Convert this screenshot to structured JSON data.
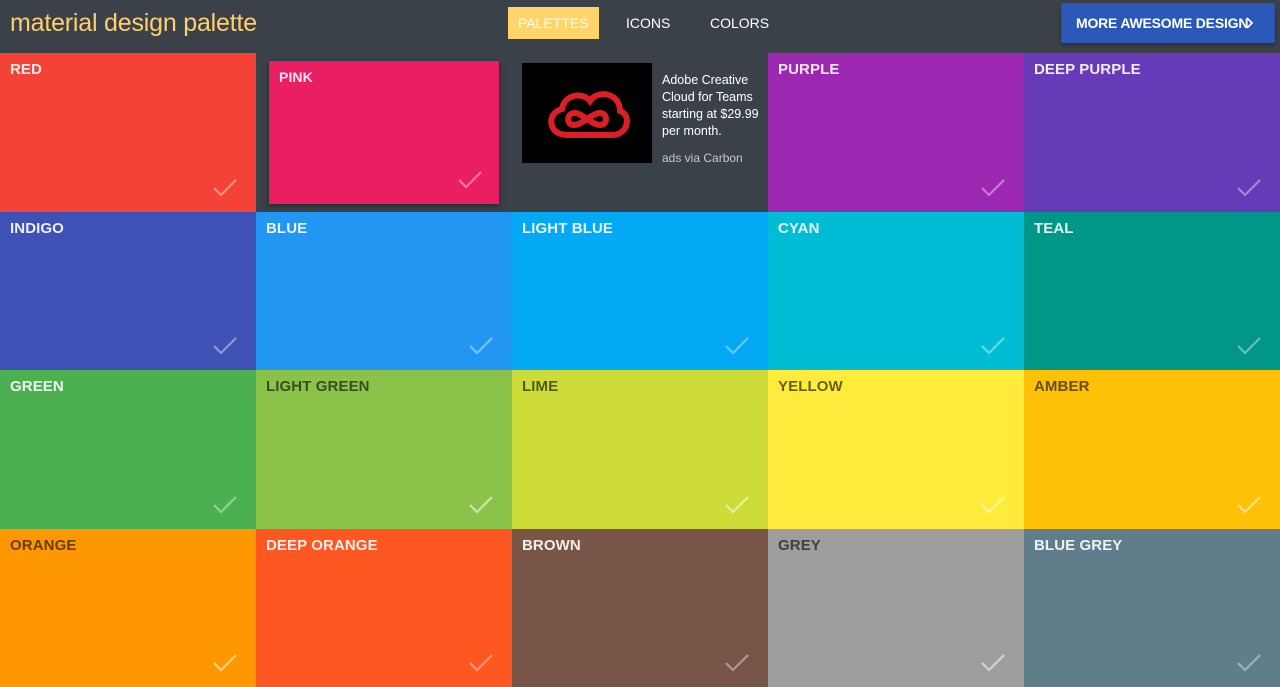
{
  "header": {
    "logo": "material design palette",
    "nav": [
      {
        "label": "PALETTES",
        "active": true
      },
      {
        "label": "ICONS",
        "active": false
      },
      {
        "label": "COLORS",
        "active": false
      }
    ],
    "cta_label": "MORE AWESOME DESIGN",
    "cta_icon": "chevron-right-icon"
  },
  "ad": {
    "text": "Adobe Creative Cloud for Teams starting at $29.99 per month.",
    "via": "ads via Carbon",
    "logo_icon": "adobe-creative-cloud-logo"
  },
  "palettes": [
    {
      "label": "RED",
      "color": "#f44336"
    },
    {
      "label": "PINK",
      "color": "#e91e63"
    },
    {
      "label": "PURPLE",
      "color": "#9c27b0"
    },
    {
      "label": "DEEP PURPLE",
      "color": "#673ab7"
    },
    {
      "label": "INDIGO",
      "color": "#3f51b5"
    },
    {
      "label": "BLUE",
      "color": "#2196f3"
    },
    {
      "label": "LIGHT BLUE",
      "color": "#03a9f4"
    },
    {
      "label": "CYAN",
      "color": "#00bcd4"
    },
    {
      "label": "TEAL",
      "color": "#009688"
    },
    {
      "label": "GREEN",
      "color": "#4caf50"
    },
    {
      "label": "LIGHT GREEN",
      "color": "#8bc34a"
    },
    {
      "label": "LIME",
      "color": "#cddc39"
    },
    {
      "label": "YELLOW",
      "color": "#ffeb3b"
    },
    {
      "label": "AMBER",
      "color": "#ffc107"
    },
    {
      "label": "ORANGE",
      "color": "#ff9800"
    },
    {
      "label": "DEEP ORANGE",
      "color": "#ff5722"
    },
    {
      "label": "BROWN",
      "color": "#795548"
    },
    {
      "label": "GREY",
      "color": "#9e9e9e"
    },
    {
      "label": "BLUE GREY",
      "color": "#607d8b"
    }
  ],
  "check_icon": "check-icon"
}
